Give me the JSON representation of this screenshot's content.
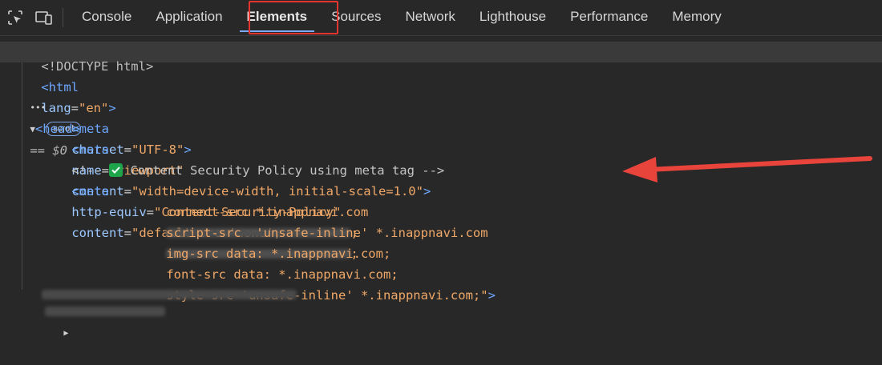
{
  "toolbar": {
    "tabs": [
      "Console",
      "Application",
      "Elements",
      "Sources",
      "Network",
      "Lighthouse",
      "Performance",
      "Memory"
    ],
    "active_tab": "Elements",
    "icons": [
      "inspect-element-icon",
      "device-toolbar-icon"
    ]
  },
  "dom": {
    "doctype": "<!DOCTYPE html>",
    "html_open": "<html",
    "html_lang_attr": "lang",
    "html_lang_value": "\"en\"",
    "html_close_bracket": ">",
    "scroll_badge": "scroll",
    "head_ellipsis": "•••",
    "head_open": "<head>",
    "head_selected_marker": "== $0",
    "meta_tag": "<meta",
    "charset_attr": "charset",
    "charset_value": "\"UTF-8\"",
    "end_bracket": ">",
    "name_attr": "name",
    "name_value": "\"viewport\"",
    "content_attr": "content",
    "viewport_content_value": "\"width=device-width, initial-scale=1.0\"",
    "comment_open": "<!-- ",
    "comment_text": " Content Security Policy using meta tag -->",
    "http_equiv_attr": "http-equiv",
    "http_equiv_value": "\"Content-Security-Policy\"",
    "csp_line1": "\"default-src 'none';",
    "csp_line2": "connect-src *.inappnavi.com",
    "csp_line2_end": ";",
    "csp_line3": "script-src  'unsafe-inline' *.inappnavi.com",
    "csp_line3_end": ";",
    "csp_line4": "img-src data: *.inappnavi.com;",
    "csp_line5": "font-src data: *.inappnavi.com;",
    "csp_line6": "style-src 'unsafe-inline' *.inappnavi.com;\"",
    "expand_triangle": "▶"
  },
  "colors": {
    "highlight_box": "#e3342f",
    "arrow": "#e8443c",
    "checkbox": "#1ea54b",
    "active_tab_underline": "#7cacf8"
  }
}
